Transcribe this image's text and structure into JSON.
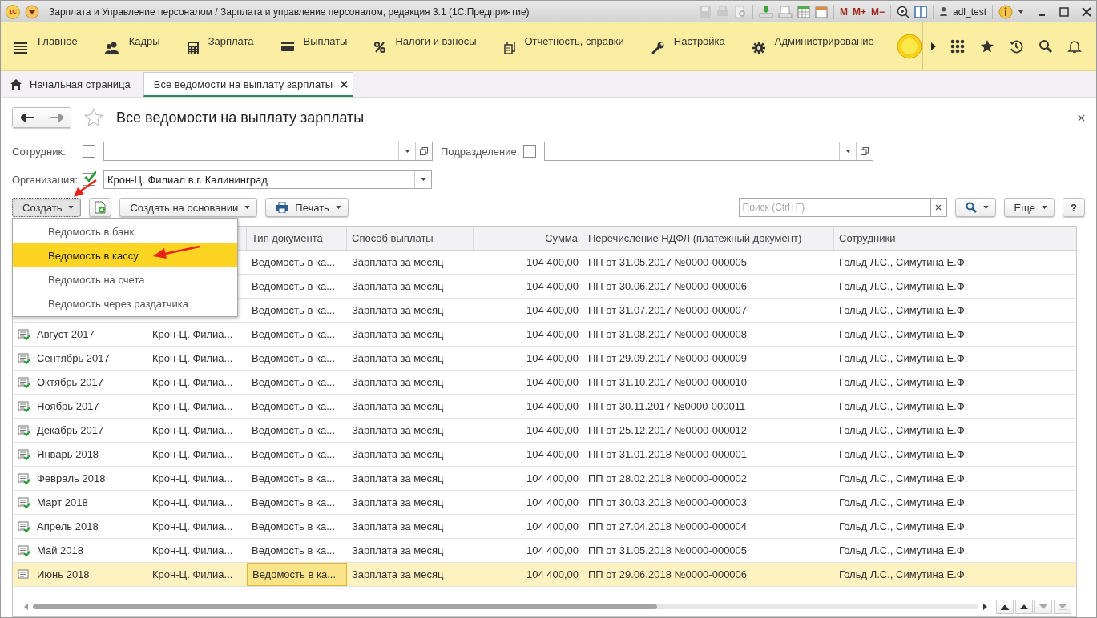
{
  "window": {
    "logo": "1С",
    "title": "Зарплата и Управление персоналом / Зарплата и управление персоналом, редакция 3.1  (1С:Предприятие)",
    "memory_buttons": [
      "M",
      "M+",
      "M−"
    ],
    "user": "adl_test"
  },
  "sections": [
    {
      "label": "Главное",
      "kind": "menu"
    },
    {
      "label": "Кадры",
      "kind": "people"
    },
    {
      "label": "Зарплата",
      "kind": "calculator"
    },
    {
      "label": "Выплаты",
      "kind": "wallet"
    },
    {
      "label": "Налоги и взносы",
      "kind": "percent"
    },
    {
      "label": "Отчетность, справки",
      "kind": "documents"
    },
    {
      "label": "Настройка",
      "kind": "wrench"
    },
    {
      "label": "Администрирование",
      "kind": "gear"
    }
  ],
  "tabs": [
    {
      "label": "Начальная страница",
      "selected": false,
      "closable": false
    },
    {
      "label": "Все ведомости на выплату зарплаты",
      "selected": true,
      "closable": true
    }
  ],
  "form": {
    "title": "Все ведомости на выплату зарплаты",
    "filters": [
      {
        "label": "Сотрудник:",
        "checked": false,
        "open_button": true
      },
      {
        "label": "Подразделение:",
        "checked": false,
        "open_button": true
      },
      {
        "label": "Организация:",
        "checked": true,
        "open_button": false,
        "value": "Крон-Ц. Филиал в г. Калининград"
      }
    ]
  },
  "toolbar": {
    "create": {
      "label": "Создать",
      "expanded": true
    },
    "create_based": "Создать на основании",
    "print": "Печать",
    "search_placeholder": "Поиск (Ctrl+F)",
    "more": "Еще",
    "help": "?"
  },
  "create_menu": [
    {
      "label": "Ведомость в банк",
      "selected": false
    },
    {
      "label": "Ведомость в кассу",
      "selected": true
    },
    {
      "label": "Ведомость на счета",
      "selected": false
    },
    {
      "label": "Ведомость через раздатчика",
      "selected": false
    }
  ],
  "table": {
    "columns": [
      "Тип документа",
      "Способ выплаты",
      "Сумма",
      "Перечисление НДФЛ (платежный документ)",
      "Сотрудники"
    ],
    "rows": [
      {
        "type": "Ведомость в ка...",
        "method": "Зарплата за месяц",
        "sum": "104 400,00",
        "ndfl": "ПП от 31.05.2017 №0000-000005",
        "staff": "Гольд Л.С., Симутина Е.Ф.",
        "selected": false
      },
      {
        "type": "Ведомость в ка...",
        "method": "Зарплата за месяц",
        "sum": "104 400,00",
        "ndfl": "ПП от 30.06.2017 №0000-000006",
        "staff": "Гольд Л.С., Симутина Е.Ф.",
        "selected": false
      },
      {
        "type": "Ведомость в ка...",
        "method": "Зарплата за месяц",
        "sum": "104 400,00",
        "ndfl": "ПП от 31.07.2017 №0000-000007",
        "staff": "Гольд Л.С., Симутина Е.Ф.",
        "selected": false
      },
      {
        "posted": true,
        "period": "Август 2017",
        "organization": "Крон-Ц. Филиа...",
        "type": "Ведомость в ка...",
        "method": "Зарплата за месяц",
        "sum": "104 400,00",
        "ndfl": "ПП от 31.08.2017 №0000-000008",
        "staff": "Гольд Л.С., Симутина Е.Ф.",
        "selected": false
      },
      {
        "posted": true,
        "period": "Сентябрь 2017",
        "organization": "Крон-Ц. Филиа...",
        "type": "Ведомость в ка...",
        "method": "Зарплата за месяц",
        "sum": "104 400,00",
        "ndfl": "ПП от 29.09.2017 №0000-000009",
        "staff": "Гольд Л.С., Симутина Е.Ф.",
        "selected": false
      },
      {
        "posted": true,
        "period": "Октябрь 2017",
        "organization": "Крон-Ц. Филиа...",
        "type": "Ведомость в ка...",
        "method": "Зарплата за месяц",
        "sum": "104 400,00",
        "ndfl": "ПП от 31.10.2017 №0000-000010",
        "staff": "Гольд Л.С., Симутина Е.Ф.",
        "selected": false
      },
      {
        "posted": true,
        "period": "Ноябрь 2017",
        "organization": "Крон-Ц. Филиа...",
        "type": "Ведомость в ка...",
        "method": "Зарплата за месяц",
        "sum": "104 400,00",
        "ndfl": "ПП от 30.11.2017 №0000-000011",
        "staff": "Гольд Л.С., Симутина Е.Ф.",
        "selected": false
      },
      {
        "posted": true,
        "period": "Декабрь 2017",
        "organization": "Крон-Ц. Филиа...",
        "type": "Ведомость в ка...",
        "method": "Зарплата за месяц",
        "sum": "104 400,00",
        "ndfl": "ПП от 25.12.2017 №0000-000012",
        "staff": "Гольд Л.С., Симутина Е.Ф.",
        "selected": false
      },
      {
        "posted": true,
        "period": "Январь 2018",
        "organization": "Крон-Ц. Филиа...",
        "type": "Ведомость в ка...",
        "method": "Зарплата за месяц",
        "sum": "104 400,00",
        "ndfl": "ПП от 31.01.2018 №0000-000001",
        "staff": "Гольд Л.С., Симутина Е.Ф.",
        "selected": false
      },
      {
        "posted": true,
        "period": "Февраль 2018",
        "organization": "Крон-Ц. Филиа...",
        "type": "Ведомость в ка...",
        "method": "Зарплата за месяц",
        "sum": "104 400,00",
        "ndfl": "ПП от 28.02.2018 №0000-000002",
        "staff": "Гольд Л.С., Симутина Е.Ф.",
        "selected": false
      },
      {
        "posted": true,
        "period": "Март 2018",
        "organization": "Крон-Ц. Филиа...",
        "type": "Ведомость в ка...",
        "method": "Зарплата за месяц",
        "sum": "104 400,00",
        "ndfl": "ПП от 30.03.2018 №0000-000003",
        "staff": "Гольд Л.С., Симутина Е.Ф.",
        "selected": false
      },
      {
        "posted": true,
        "period": "Апрель 2018",
        "organization": "Крон-Ц. Филиа...",
        "type": "Ведомость в ка...",
        "method": "Зарплата за месяц",
        "sum": "104 400,00",
        "ndfl": "ПП от 27.04.2018 №0000-000004",
        "staff": "Гольд Л.С., Симутина Е.Ф.",
        "selected": false
      },
      {
        "posted": true,
        "period": "Май 2018",
        "organization": "Крон-Ц. Филиа...",
        "type": "Ведомость в ка...",
        "method": "Зарплата за месяц",
        "sum": "104 400,00",
        "ndfl": "ПП от 31.05.2018 №0000-000005",
        "staff": "Гольд Л.С., Симутина Е.Ф.",
        "selected": false
      },
      {
        "posted": false,
        "period": "Июнь 2018",
        "organization": "Крон-Ц. Филиа...",
        "type": "Ведомость в ка...",
        "method": "Зарплата за месяц",
        "sum": "104 400,00",
        "ndfl": "ПП от 29.06.2018 №0000-000006",
        "staff": "Гольд Л.С., Симутина Е.Ф.",
        "selected": true
      }
    ]
  }
}
